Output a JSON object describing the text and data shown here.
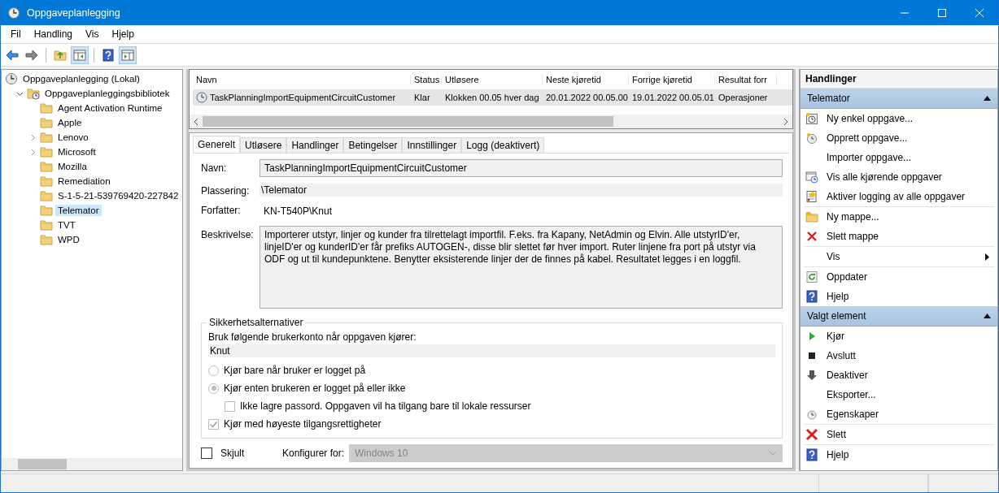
{
  "window": {
    "title": "Oppgaveplanlegging"
  },
  "menu": [
    "Fil",
    "Handling",
    "Vis",
    "Hjelp"
  ],
  "toolbar": [
    {
      "pressed": false
    },
    {
      "pressed": false
    },
    {
      "pressed": false
    },
    {
      "pressed": true
    },
    {
      "pressed": false
    },
    {
      "pressed": true
    }
  ],
  "tree": [
    {
      "label": "Oppgaveplanlegging (Lokal)",
      "selected": false,
      "children": [
        {
          "label": "Oppgaveplanleggingsbibliotek",
          "expanded": true,
          "selected": false,
          "children": [
            {
              "label": "Agent Activation Runtime",
              "selected": false
            },
            {
              "label": "Apple",
              "selected": false
            },
            {
              "label": "Lenovo",
              "expanded": false,
              "selected": false
            },
            {
              "label": "Microsoft",
              "expanded": false,
              "selected": false
            },
            {
              "label": "Mozilla",
              "selected": false
            },
            {
              "label": "Remediation",
              "selected": false
            },
            {
              "label": "S-1-5-21-539769420-227842",
              "selected": false
            },
            {
              "label": "Telemator",
              "selected": true
            },
            {
              "label": "TVT",
              "selected": false
            },
            {
              "label": "WPD",
              "selected": false
            }
          ]
        }
      ]
    }
  ],
  "task_list": {
    "columns": [
      "Navn",
      "Status",
      "Utløsere",
      "Neste kjøretid",
      "Forrige kjøretid",
      "Resultat forr"
    ],
    "rows": [
      {
        "selected": true,
        "cells": [
          "TaskPlanningImportEquipmentCircuitCustomer",
          "Klar",
          "Klokken 00.05 hver dag",
          "20.01.2022 00.05.00",
          "19.01.2022 00.05.01",
          "Operasjoner"
        ]
      }
    ]
  },
  "tabs": [
    {
      "label": "Generelt",
      "selected": true
    },
    {
      "label": "Utløsere",
      "selected": false
    },
    {
      "label": "Handlinger",
      "selected": false
    },
    {
      "label": "Betingelser",
      "selected": false
    },
    {
      "label": "Innstillinger",
      "selected": false
    },
    {
      "label": "Logg (deaktivert)",
      "selected": false
    }
  ],
  "general": [
    {
      "kind": "field",
      "label": "Navn:",
      "value": "TaskPlanningImportEquipmentCircuitCustomer"
    },
    {
      "kind": "shaded",
      "label": "Plassering:",
      "value": "\\Telemator"
    },
    {
      "kind": "text",
      "label": "Forfatter:",
      "value": "KN-T540P\\Knut"
    },
    {
      "kind": "area",
      "label": "Beskrivelse:",
      "value": "Importerer utstyr, linjer og kunder fra tilrettelagt importfil.  F.eks. fra Kapany, NetAdmin og Elvin.  Alle utstyrID'er, linjeID'er og kunderID'er får prefiks AUTOGEN-, disse blir slettet før hver import.  Ruter linjene fra port på utstyr via ODF og ut til kundepunktene.  Benytter eksisterende linjer der de finnes på kabel.  Resultatet legges i en loggfil."
    }
  ],
  "security": {
    "title": "Sikkerhetsalternativer",
    "prompt": "Bruk følgende brukerkonto når oppgaven kjører:",
    "account": "Knut",
    "options": [
      {
        "kind": "radio",
        "label": "Kjør bare når bruker er logget på",
        "selected": false
      },
      {
        "kind": "radio",
        "label": "Kjør enten brukeren er logget på eller ikke",
        "selected": true,
        "children": [
          {
            "kind": "checkbox",
            "label": "Ikke lagre passord. Oppgaven vil ha tilgang bare til lokale ressurser",
            "checked": false
          }
        ]
      },
      {
        "kind": "checkbox",
        "label": "Kjør med høyeste tilgangsrettigheter",
        "checked": true
      }
    ]
  },
  "hidden": {
    "label": "Skjult",
    "checked": false
  },
  "configure": {
    "label": "Konfigurer for:",
    "value": "Windows 10",
    "disabled": true
  },
  "actions": {
    "title": "Handlinger",
    "sections": [
      {
        "title": "Telemator",
        "expanded": true,
        "groups": [
          [
            {
              "label": "Ny enkel oppgave...",
              "submenu": false
            },
            {
              "label": "Opprett oppgave...",
              "submenu": false
            },
            {
              "label": "Importer oppgave...",
              "submenu": false
            },
            {
              "label": "Vis alle kjørende oppgaver",
              "submenu": false
            },
            {
              "label": "Aktiver logging av alle oppgaver",
              "submenu": false
            }
          ],
          [
            {
              "label": "Ny mappe...",
              "submenu": false
            },
            {
              "label": "Slett mappe",
              "submenu": false
            }
          ],
          [
            {
              "label": "Vis",
              "submenu": true
            }
          ],
          [
            {
              "label": "Oppdater",
              "submenu": false
            },
            {
              "label": "Hjelp",
              "submenu": false
            }
          ]
        ]
      },
      {
        "title": "Valgt element",
        "expanded": true,
        "groups": [
          [
            {
              "label": "Kjør",
              "submenu": false
            },
            {
              "label": "Avslutt",
              "submenu": false
            },
            {
              "label": "Deaktiver",
              "submenu": false
            },
            {
              "label": "Eksporter...",
              "submenu": false
            },
            {
              "label": "Egenskaper",
              "submenu": false
            }
          ],
          [
            {
              "label": "Slett",
              "submenu": false
            }
          ],
          [
            {
              "label": "Hjelp",
              "submenu": false
            }
          ]
        ]
      }
    ]
  }
}
